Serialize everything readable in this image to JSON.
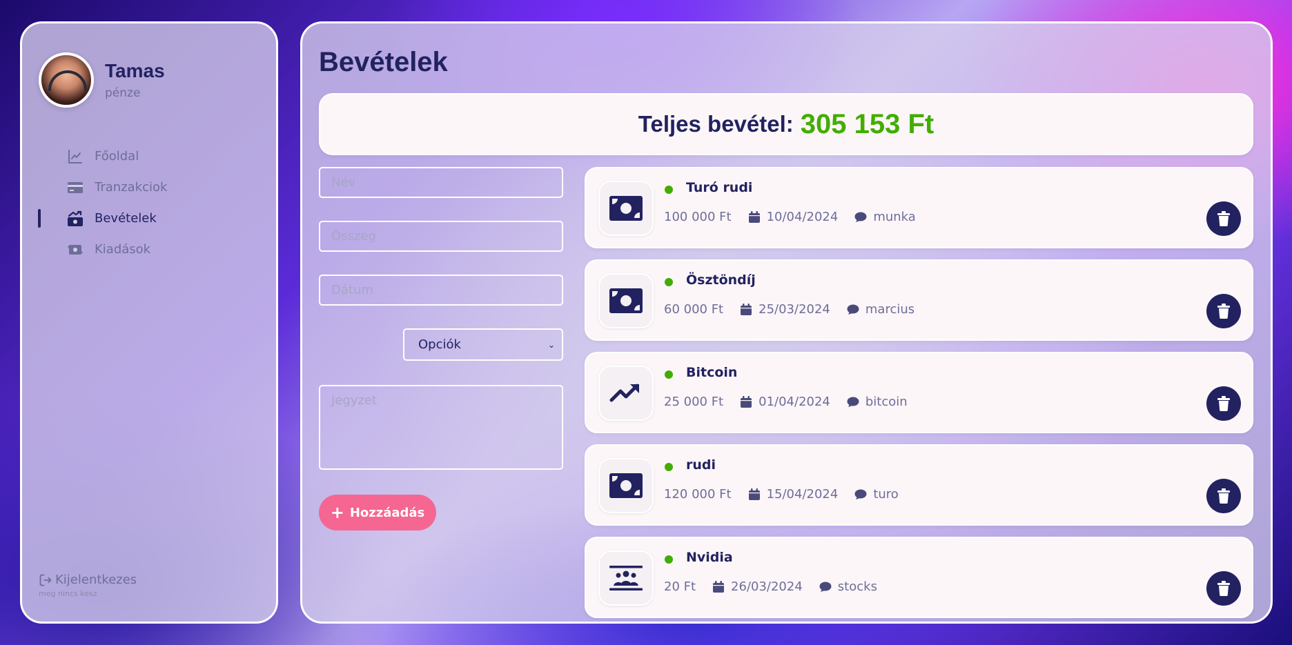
{
  "colors": {
    "accent": "#222260",
    "income_green": "#42ad00",
    "add_button": "#f56692"
  },
  "profile": {
    "name": "Tamas",
    "subtitle": "pénze"
  },
  "menu": [
    {
      "label": "Főoldal",
      "icon": "chart-line-icon",
      "active": false
    },
    {
      "label": "Tranzakciok",
      "icon": "credit-card-icon",
      "active": false
    },
    {
      "label": "Bevételek",
      "icon": "money-bill-trend-up-icon",
      "active": true
    },
    {
      "label": "Kiadások",
      "icon": "money-bill-transfer-icon",
      "active": false
    }
  ],
  "logout": {
    "label": "Kijelentkezes",
    "note": "meg nincs kesz"
  },
  "page": {
    "title": "Bevételek"
  },
  "total": {
    "label": "Teljes bevétel:",
    "value": "305 153 Ft"
  },
  "form": {
    "name_placeholder": "Név",
    "amount_placeholder": "Összeg",
    "date_placeholder": "Dátum",
    "select_value": "Opciók",
    "note_placeholder": "Jegyzet",
    "add_label": "Hozzáadás"
  },
  "incomes": [
    {
      "title": "Turó rudi",
      "amount": "100 000 Ft",
      "date": "10/04/2024",
      "comment": "munka",
      "icon": "money-bill-icon"
    },
    {
      "title": "Ösztöndíj",
      "amount": "60 000 Ft",
      "date": "25/03/2024",
      "comment": "marcius",
      "icon": "money-bill-icon"
    },
    {
      "title": "Bitcoin",
      "amount": "25 000 Ft",
      "date": "01/04/2024",
      "comment": "bitcoin",
      "icon": "arrow-trend-up-icon"
    },
    {
      "title": "rudi",
      "amount": "120 000 Ft",
      "date": "15/04/2024",
      "comment": "turo",
      "icon": "money-bill-icon"
    },
    {
      "title": "Nvidia",
      "amount": "20 Ft",
      "date": "26/03/2024",
      "comment": "stocks",
      "icon": "people-group-icon"
    }
  ]
}
